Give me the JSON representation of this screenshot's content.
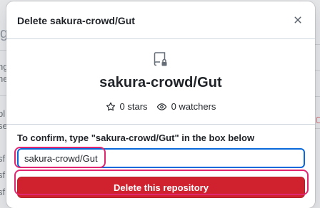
{
  "background": {
    "fragments": [
      "g",
      "ng",
      "ne",
      "bl",
      "se",
      "sf",
      "sf",
      "sf"
    ]
  },
  "modal": {
    "title": "Delete sakura-crowd/Gut",
    "close_icon": "x-icon",
    "repo": {
      "icon": "repo-locked-icon",
      "name": "sakura-crowd/Gut",
      "stars": "0 stars",
      "watchers": "0 watchers"
    },
    "confirm": {
      "label": "To confirm, type \"sakura-crowd/Gut\" in the box below",
      "input_value": "sakura-crowd/Gut"
    },
    "delete_button_label": "Delete this repository"
  },
  "colors": {
    "danger": "#cf222e",
    "focus": "#0969da",
    "highlight": "#e0266f"
  }
}
